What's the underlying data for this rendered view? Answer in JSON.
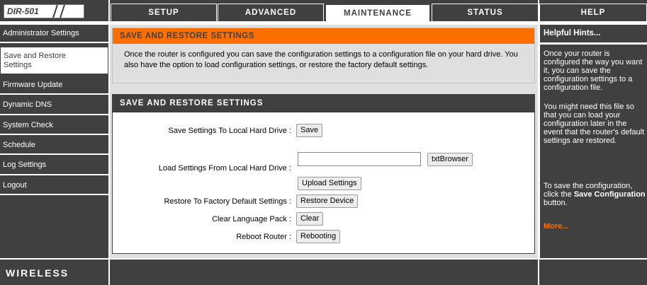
{
  "header": {
    "model": "DIR-501",
    "tabs": [
      {
        "label": "SETUP"
      },
      {
        "label": "ADVANCED"
      },
      {
        "label": "MAINTENANCE"
      },
      {
        "label": "STATUS"
      },
      {
        "label": "HELP"
      }
    ],
    "active_tab": "MAINTENANCE"
  },
  "sidebar": {
    "items": [
      {
        "label": "Administrator Settings"
      },
      {
        "label": "Save and Restore Settings"
      },
      {
        "label": "Firmware Update"
      },
      {
        "label": "Dynamic DNS"
      },
      {
        "label": "System Check"
      },
      {
        "label": "Schedule"
      },
      {
        "label": "Log Settings"
      },
      {
        "label": "Logout"
      }
    ],
    "active_item": "Save and Restore Settings"
  },
  "intro": {
    "title": "SAVE AND RESTORE SETTINGS",
    "text": "Once the router is configured you can save the configuration settings to a configuration file on your hard drive. You also have the option to load configuration settings, or restore the factory default settings."
  },
  "form": {
    "title": "SAVE AND RESTORE SETTINGS",
    "save_label": "Save Settings To Local Hard Drive :",
    "save_button": "Save",
    "load_label": "Load Settings From Local Hard Drive :",
    "file_value": "",
    "browse_button": "txtBrowser",
    "upload_button": "Upload Settings",
    "restore_label": "Restore To Factory Default Settings :",
    "restore_button": "Restore Device",
    "clear_label": "Clear Language Pack :",
    "clear_button": "Clear",
    "reboot_label": "Reboot Router :",
    "reboot_button": "Rebooting"
  },
  "help": {
    "title": "Helpful Hints...",
    "p1": "Once your router is configured the way you want it, you can save the configuration settings to a configuration file.",
    "p2": "You might need this file so that you can load your configuration later in the event that the router's default settings are restored.",
    "p3_prefix": "To save the configuration, click the",
    "p3_bold": "Save Configuration",
    "p3_suffix": "button.",
    "more": "More..."
  },
  "footer": {
    "brand": "WIRELESS"
  },
  "colors": {
    "dark_gray": "#404040",
    "orange": "#ff6f00",
    "panel_gray": "#dfdfdf"
  }
}
